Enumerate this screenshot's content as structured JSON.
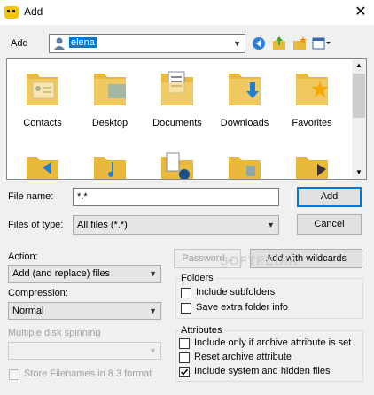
{
  "window": {
    "title": "Add",
    "close_glyph": "✕"
  },
  "look_in": {
    "label": "Add",
    "value": "elena"
  },
  "files": [
    {
      "name": "Contacts",
      "icon": "contacts-folder-icon"
    },
    {
      "name": "Desktop",
      "icon": "desktop-folder-icon"
    },
    {
      "name": "Documents",
      "icon": "documents-folder-icon"
    },
    {
      "name": "Downloads",
      "icon": "downloads-folder-icon"
    },
    {
      "name": "Favorites",
      "icon": "favorites-folder-icon"
    }
  ],
  "filename": {
    "label": "File name:",
    "value": "*.*"
  },
  "filetype": {
    "label": "Files of type:",
    "value": "All files (*.*)"
  },
  "buttons": {
    "add": "Add",
    "cancel": "Cancel",
    "password": "Password...",
    "add_wildcards": "Add with wildcards"
  },
  "action": {
    "label": "Action:",
    "value": "Add (and replace) files"
  },
  "compression": {
    "label": "Compression:",
    "value": "Normal"
  },
  "spanning": {
    "label": "Multiple disk spinning",
    "value": ""
  },
  "store_83": {
    "label": "Store Filenames in 8.3 format",
    "checked": false
  },
  "folders": {
    "title": "Folders",
    "include_subfolders": {
      "label": "Include subfolders",
      "checked": false
    },
    "save_extra": {
      "label": "Save extra folder info",
      "checked": false
    }
  },
  "attributes": {
    "title": "Attributes",
    "archive_only": {
      "label": "Include only if archive attribute is set",
      "checked": false
    },
    "reset_archive": {
      "label": "Reset archive attribute",
      "checked": false
    },
    "system_hidden": {
      "label": "Include system and hidden files",
      "checked": true
    }
  },
  "watermark": "SOFTPEDIA"
}
